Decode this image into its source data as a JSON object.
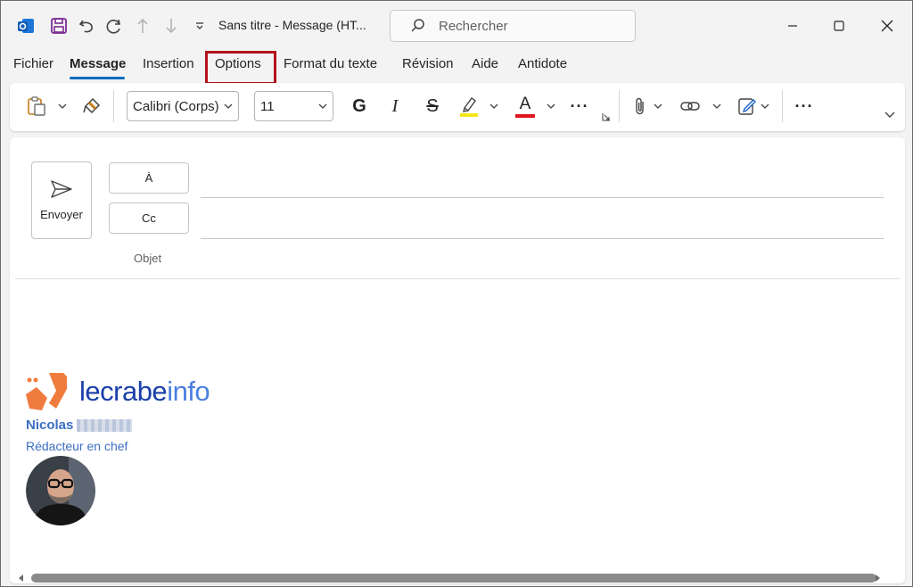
{
  "titlebar": {
    "title": "Sans titre  -  Message (HT...",
    "search_placeholder": "Rechercher",
    "icons": [
      "outlook-icon",
      "save-icon",
      "undo-icon",
      "redo-icon",
      "arrow-up-icon",
      "arrow-down-icon",
      "customize-icon"
    ]
  },
  "tabs": [
    {
      "label": "Fichier"
    },
    {
      "label": "Message"
    },
    {
      "label": "Insertion"
    },
    {
      "label": "Options"
    },
    {
      "label": "Format du texte"
    },
    {
      "label": "Révision"
    },
    {
      "label": "Aide"
    },
    {
      "label": "Antidote"
    }
  ],
  "ribbon": {
    "font_name": "Calibri (Corps)",
    "font_size": "11",
    "bold": "G",
    "italic": "I",
    "strike": "S",
    "font_color_letter": "A",
    "more": "···",
    "highlight_color": "#f5e61a",
    "font_color": "#e0141e"
  },
  "compose": {
    "send_label": "Envoyer",
    "to_label": "À",
    "cc_label": "Cc",
    "subject_label": "Objet",
    "to_value": "",
    "cc_value": ""
  },
  "signature": {
    "brand_part1": "lecrabe",
    "brand_part2": "info",
    "name": "Nicolas",
    "title": "Rédacteur en chef",
    "brand_color": "#f07b3f"
  }
}
